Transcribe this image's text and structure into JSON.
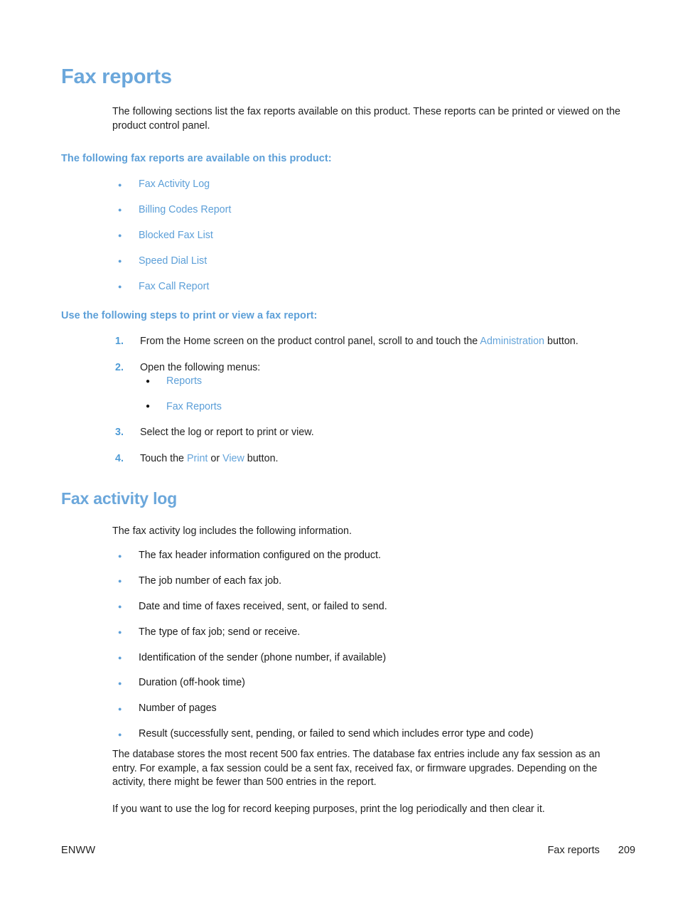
{
  "page": {
    "title": "Fax reports",
    "intro": "The following sections list the fax reports available on this product. These reports can be printed or viewed on the product control panel."
  },
  "reports_section": {
    "heading": "The following fax reports are available on this product:",
    "items": [
      "Fax Activity Log",
      "Billing Codes Report",
      "Blocked Fax List",
      "Speed Dial List",
      "Fax Call Report"
    ]
  },
  "steps_section": {
    "heading": "Use the following steps to print or view a fax report:",
    "steps": [
      {
        "num": "1.",
        "text_before": "From the Home screen on the product control panel, scroll to and touch the ",
        "link": "Administration",
        "text_after": " button."
      },
      {
        "num": "2.",
        "text_before": "Open the following menus:",
        "link": "",
        "text_after": "",
        "substeps": [
          "Reports",
          "Fax Reports"
        ]
      },
      {
        "num": "3.",
        "text_before": "Select the log or report to print or view.",
        "link": "",
        "text_after": ""
      },
      {
        "num": "4.",
        "text_before": "Touch the ",
        "link": "Print",
        "text_mid": " or ",
        "link2": "View",
        "text_after": " button."
      }
    ]
  },
  "activity_section": {
    "heading": "Fax activity log",
    "intro": "The fax activity log includes the following information.",
    "items": [
      "The fax header information configured on the product.",
      "The job number of each fax job.",
      "Date and time of faxes received, sent, or failed to send.",
      "The type of fax job; send or receive.",
      "Identification of the sender (phone number, if available)",
      "Duration (off-hook time)",
      "Number of pages",
      "Result (successfully sent, pending, or failed to send which includes error type and code)"
    ],
    "para1": "The database stores the most recent 500 fax entries. The database fax entries include any fax session as an entry. For example, a fax session could be a sent fax, received fax, or firmware upgrades. Depending on the activity, there might be fewer than 500 entries in the report.",
    "para2": "If you want to use the log for record keeping purposes, print the log periodically and then clear it."
  },
  "footer": {
    "left": "ENWW",
    "section": "Fax reports",
    "page_number": "209"
  },
  "colors": {
    "heading_blue": "#6ba7db",
    "link_blue": "#64a4da",
    "subheading_blue": "#5c9fd8",
    "body_text": "#1f1f1f"
  }
}
